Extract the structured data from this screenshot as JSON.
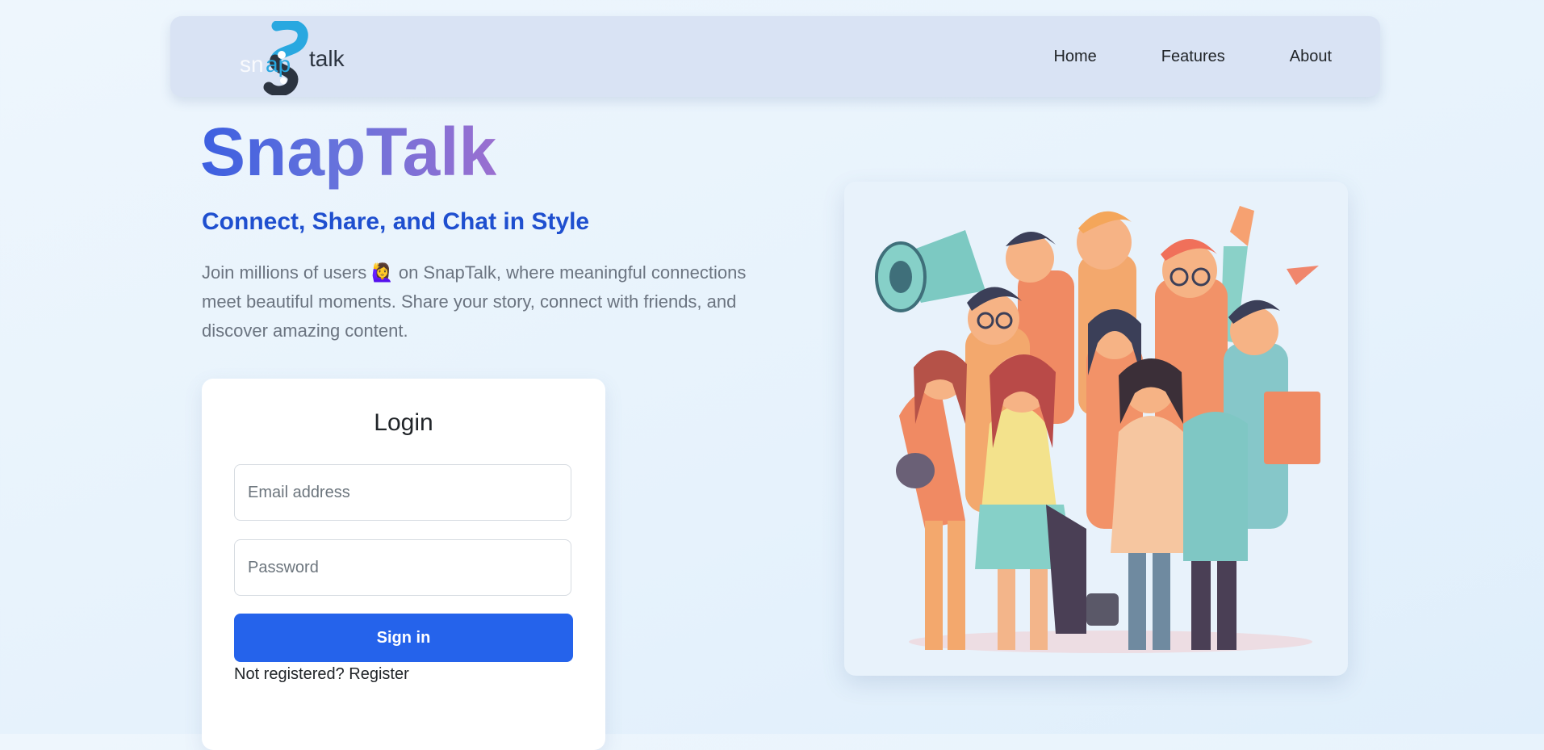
{
  "navbar": {
    "logo": {
      "text_left": "snap",
      "text_right": "talk",
      "icon": "snaptalk-logo-icon"
    },
    "links": [
      {
        "label": "Home"
      },
      {
        "label": "Features"
      },
      {
        "label": "About"
      }
    ]
  },
  "hero": {
    "title": "SnapTalk",
    "subtitle": "Connect, Share, and Chat in Style",
    "description_before_emoji": "Join millions of users ",
    "emoji": "🙋‍♀️",
    "description_after_emoji": " on SnapTalk, where meaningful connections meet beautiful moments. Share your story, connect with friends, and discover amazing content."
  },
  "login": {
    "title": "Login",
    "email_placeholder": "Email address",
    "email_value": "",
    "password_placeholder": "Password",
    "password_value": "",
    "signin_label": "Sign in",
    "register_prefix": "Not registered? ",
    "register_link": "Register"
  },
  "colors": {
    "page_background": "#e8f3fc",
    "navbar_background": "#d9e3f4",
    "primary_button": "#2563eb",
    "subtitle": "#1f4fcf",
    "title_gradient_start": "#3c5fe0",
    "title_gradient_end": "#9a6fd0"
  },
  "illustration": {
    "icon": "group-of-people-illustration"
  }
}
